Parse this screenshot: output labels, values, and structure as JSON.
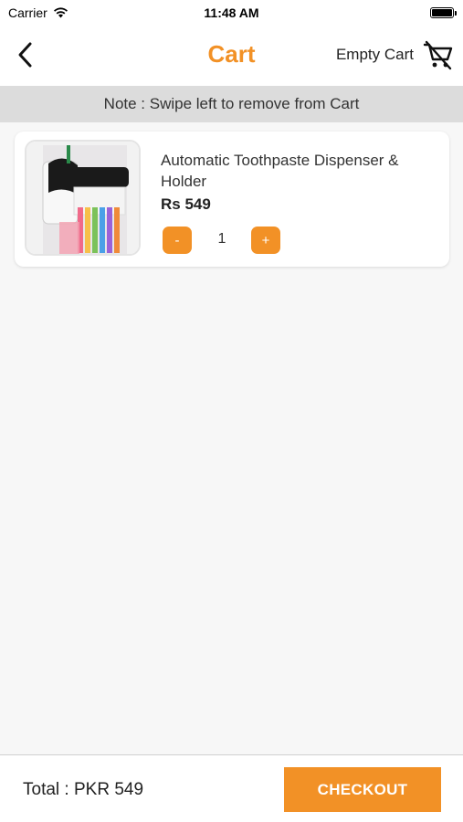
{
  "status_bar": {
    "carrier": "Carrier",
    "time": "11:48 AM",
    "wifi_icon": "wifi-icon",
    "battery_icon": "battery-full-icon"
  },
  "header": {
    "title": "Cart",
    "back_icon": "chevron-left-icon",
    "empty_cart_label": "Empty Cart",
    "empty_cart_icon": "cart-remove-icon",
    "accent_color": "#f29126"
  },
  "note": {
    "text": "Note : Swipe left to remove from Cart"
  },
  "cart": {
    "items": [
      {
        "name": "Automatic Toothpaste Dispenser & Holder",
        "price": "Rs 549",
        "quantity": "1",
        "minus_label": "-",
        "plus_label": "+"
      }
    ]
  },
  "footer": {
    "total": "Total : PKR 549",
    "checkout_label": "CHECKOUT"
  }
}
